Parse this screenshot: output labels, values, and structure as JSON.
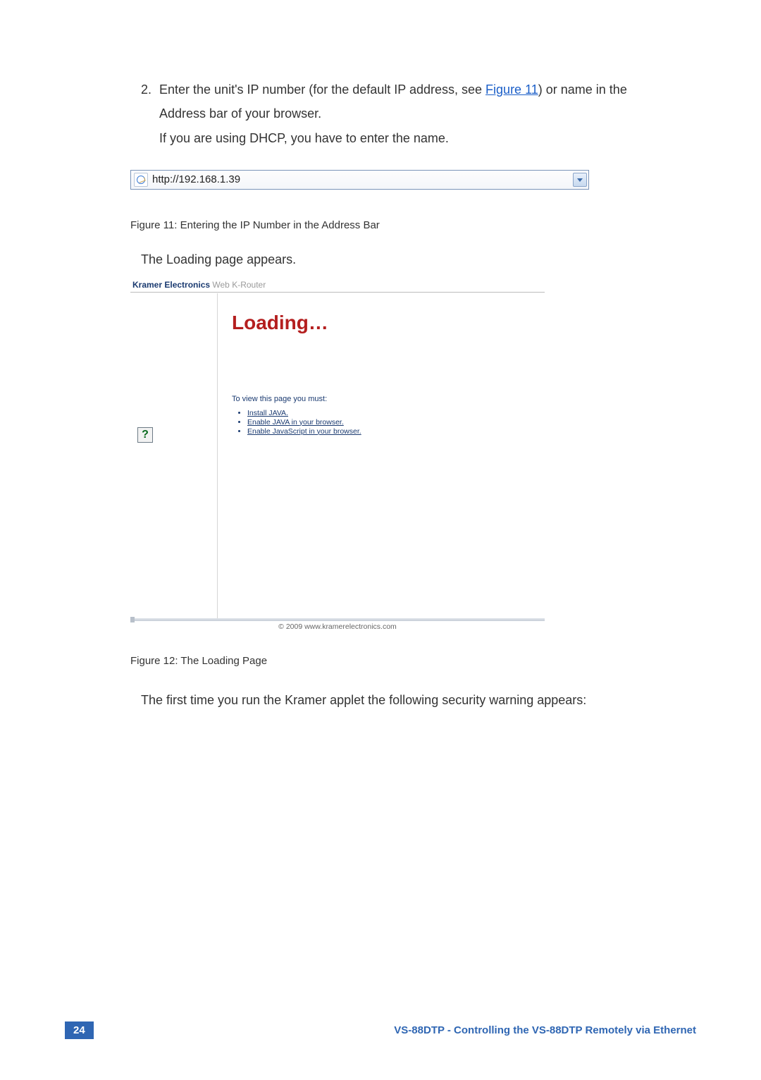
{
  "step": {
    "number": "2.",
    "text_a": "Enter the unit's IP number (for the default IP address, see ",
    "link": "Figure 11",
    "text_b": ") or name in the Address bar of your browser.",
    "text_c": "If you are using DHCP, you have to enter the name."
  },
  "address_bar": {
    "url": "http://192.168.1.39"
  },
  "caption11": "Figure 11: Entering the IP Number in the Address Bar",
  "para_loading": "The Loading page appears.",
  "kr": {
    "brand": "Kramer Electronics",
    "sub": " Web K-Router",
    "loading": "Loading…",
    "must": "To view this page you must:",
    "req1": "Install JAVA.",
    "req2": "Enable JAVA in your browser.",
    "req3": "Enable JavaScript in your browser.",
    "footer": "© 2009 www.kramerelectronics.com",
    "qmark": "?"
  },
  "caption12": "Figure 12: The Loading Page",
  "after": "The first time you run the Kramer applet the following security warning appears:",
  "docfooter": {
    "page": "24",
    "title": "VS-88DTP - Controlling the VS-88DTP Remotely via Ethernet"
  }
}
